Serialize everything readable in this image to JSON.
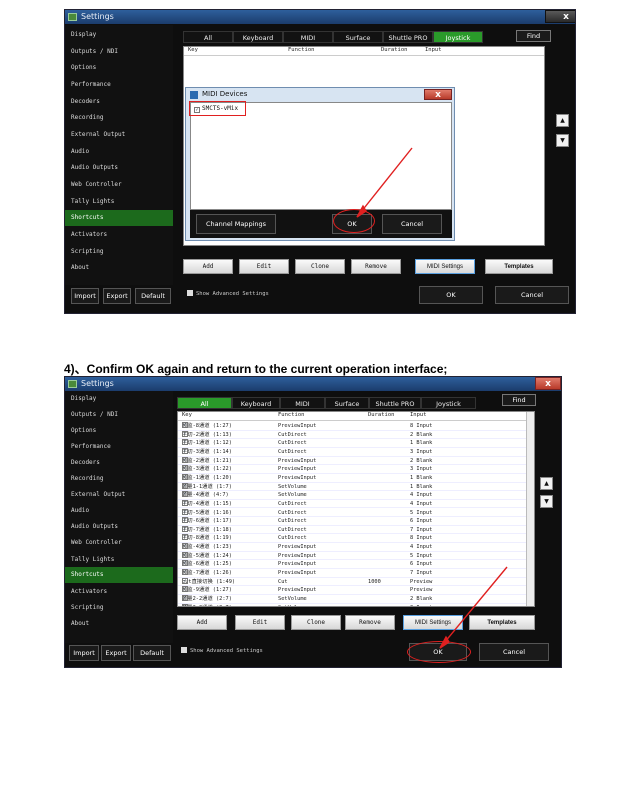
{
  "caption": "4)、Confirm OK again and return to the current operation interface;",
  "window_title": "Settings",
  "close_glyph": "x",
  "sidebar_items": [
    "Display",
    "Outputs / NDI",
    "Options",
    "Performance",
    "Decoders",
    "Recording",
    "External Output",
    "Audio",
    "Audio Outputs",
    "Web Controller",
    "Tally Lights",
    "Shortcuts",
    "Activators",
    "Scripting",
    "About"
  ],
  "selected_sidebar": "Shortcuts",
  "tabs": [
    "All",
    "Keyboard",
    "MIDI",
    "Surface",
    "Shuttle PRO",
    "Joystick"
  ],
  "active_tab": "Joystick",
  "find_label": "Find",
  "columns": [
    "Key",
    "Function",
    "Duration",
    "Input"
  ],
  "bottom_left_buttons": [
    "Import",
    "Export",
    "Default"
  ],
  "action_buttons": [
    "Add",
    "Edit",
    "Clone",
    "Remove",
    "MIDI Settings",
    "Templates"
  ],
  "show_advanced_label": "Show Advanced Settings",
  "ok_label": "OK",
  "cancel_label": "Cancel",
  "scroll_up_glyph": "▲",
  "scroll_down_glyph": "▼",
  "midi_dialog": {
    "title": "MIDI Devices",
    "device": "SMCTS-vMix",
    "channel_mappings_label": "Channel Mappings",
    "ok_label": "OK",
    "cancel_label": "Cancel"
  },
  "rows": [
    {
      "key": "预监-8通道 (1:27)",
      "function": "PreviewInput",
      "duration": "",
      "input": "8 Input"
    },
    {
      "key": "主切-2通道 (1:13)",
      "function": "CutDirect",
      "duration": "",
      "input": "2 Blank"
    },
    {
      "key": "主切-1通道 (1:12)",
      "function": "CutDirect",
      "duration": "",
      "input": "1 Blank"
    },
    {
      "key": "主切-3通道 (1:14)",
      "function": "CutDirect",
      "duration": "",
      "input": "3 Input"
    },
    {
      "key": "预监-2通道 (1:21)",
      "function": "PreviewInput",
      "duration": "",
      "input": "2 Blank"
    },
    {
      "key": "预监-3通道 (1:22)",
      "function": "PreviewInput",
      "duration": "",
      "input": "3 Input"
    },
    {
      "key": "预监-1通道 (1:20)",
      "function": "PreviewInput",
      "duration": "",
      "input": "1 Blank"
    },
    {
      "key": "音量1-1通道 (1:7)",
      "function": "SetVolume",
      "duration": "",
      "input": "1 Blank"
    },
    {
      "key": "音量-4通道 (4:7)",
      "function": "SetVolume",
      "duration": "",
      "input": "4 Input"
    },
    {
      "key": "主切-4通道 (1:15)",
      "function": "CutDirect",
      "duration": "",
      "input": "4 Input"
    },
    {
      "key": "主切-5通道 (1:16)",
      "function": "CutDirect",
      "duration": "",
      "input": "5 Input"
    },
    {
      "key": "主切-6通道 (1:17)",
      "function": "CutDirect",
      "duration": "",
      "input": "6 Input"
    },
    {
      "key": "主切-7通道 (1:18)",
      "function": "CutDirect",
      "duration": "",
      "input": "7 Input"
    },
    {
      "key": "主切-8通道 (1:19)",
      "function": "CutDirect",
      "duration": "",
      "input": "8 Input"
    },
    {
      "key": "预监-4通道 (1:23)",
      "function": "PreviewInput",
      "duration": "",
      "input": "4 Input"
    },
    {
      "key": "预监-5通道 (1:24)",
      "function": "PreviewInput",
      "duration": "",
      "input": "5 Input"
    },
    {
      "key": "预监-6通道 (1:25)",
      "function": "PreviewInput",
      "duration": "",
      "input": "6 Input"
    },
    {
      "key": "预监-7通道 (1:26)",
      "function": "PreviewInput",
      "duration": "",
      "input": "7 Input"
    },
    {
      "key": "cut直接切换 (1:49)",
      "function": "Cut",
      "duration": "1000",
      "input": "Preview"
    },
    {
      "key": "预监-9通道 (1:27)",
      "function": "PreviewInput",
      "duration": "",
      "input": "Preview"
    },
    {
      "key": "音量2-2通道 (2:7)",
      "function": "SetVolume",
      "duration": "",
      "input": "2 Blank"
    },
    {
      "key": "音量3-3通道 (3:7)",
      "function": "SetVolume",
      "duration": "",
      "input": "3 Input"
    }
  ]
}
